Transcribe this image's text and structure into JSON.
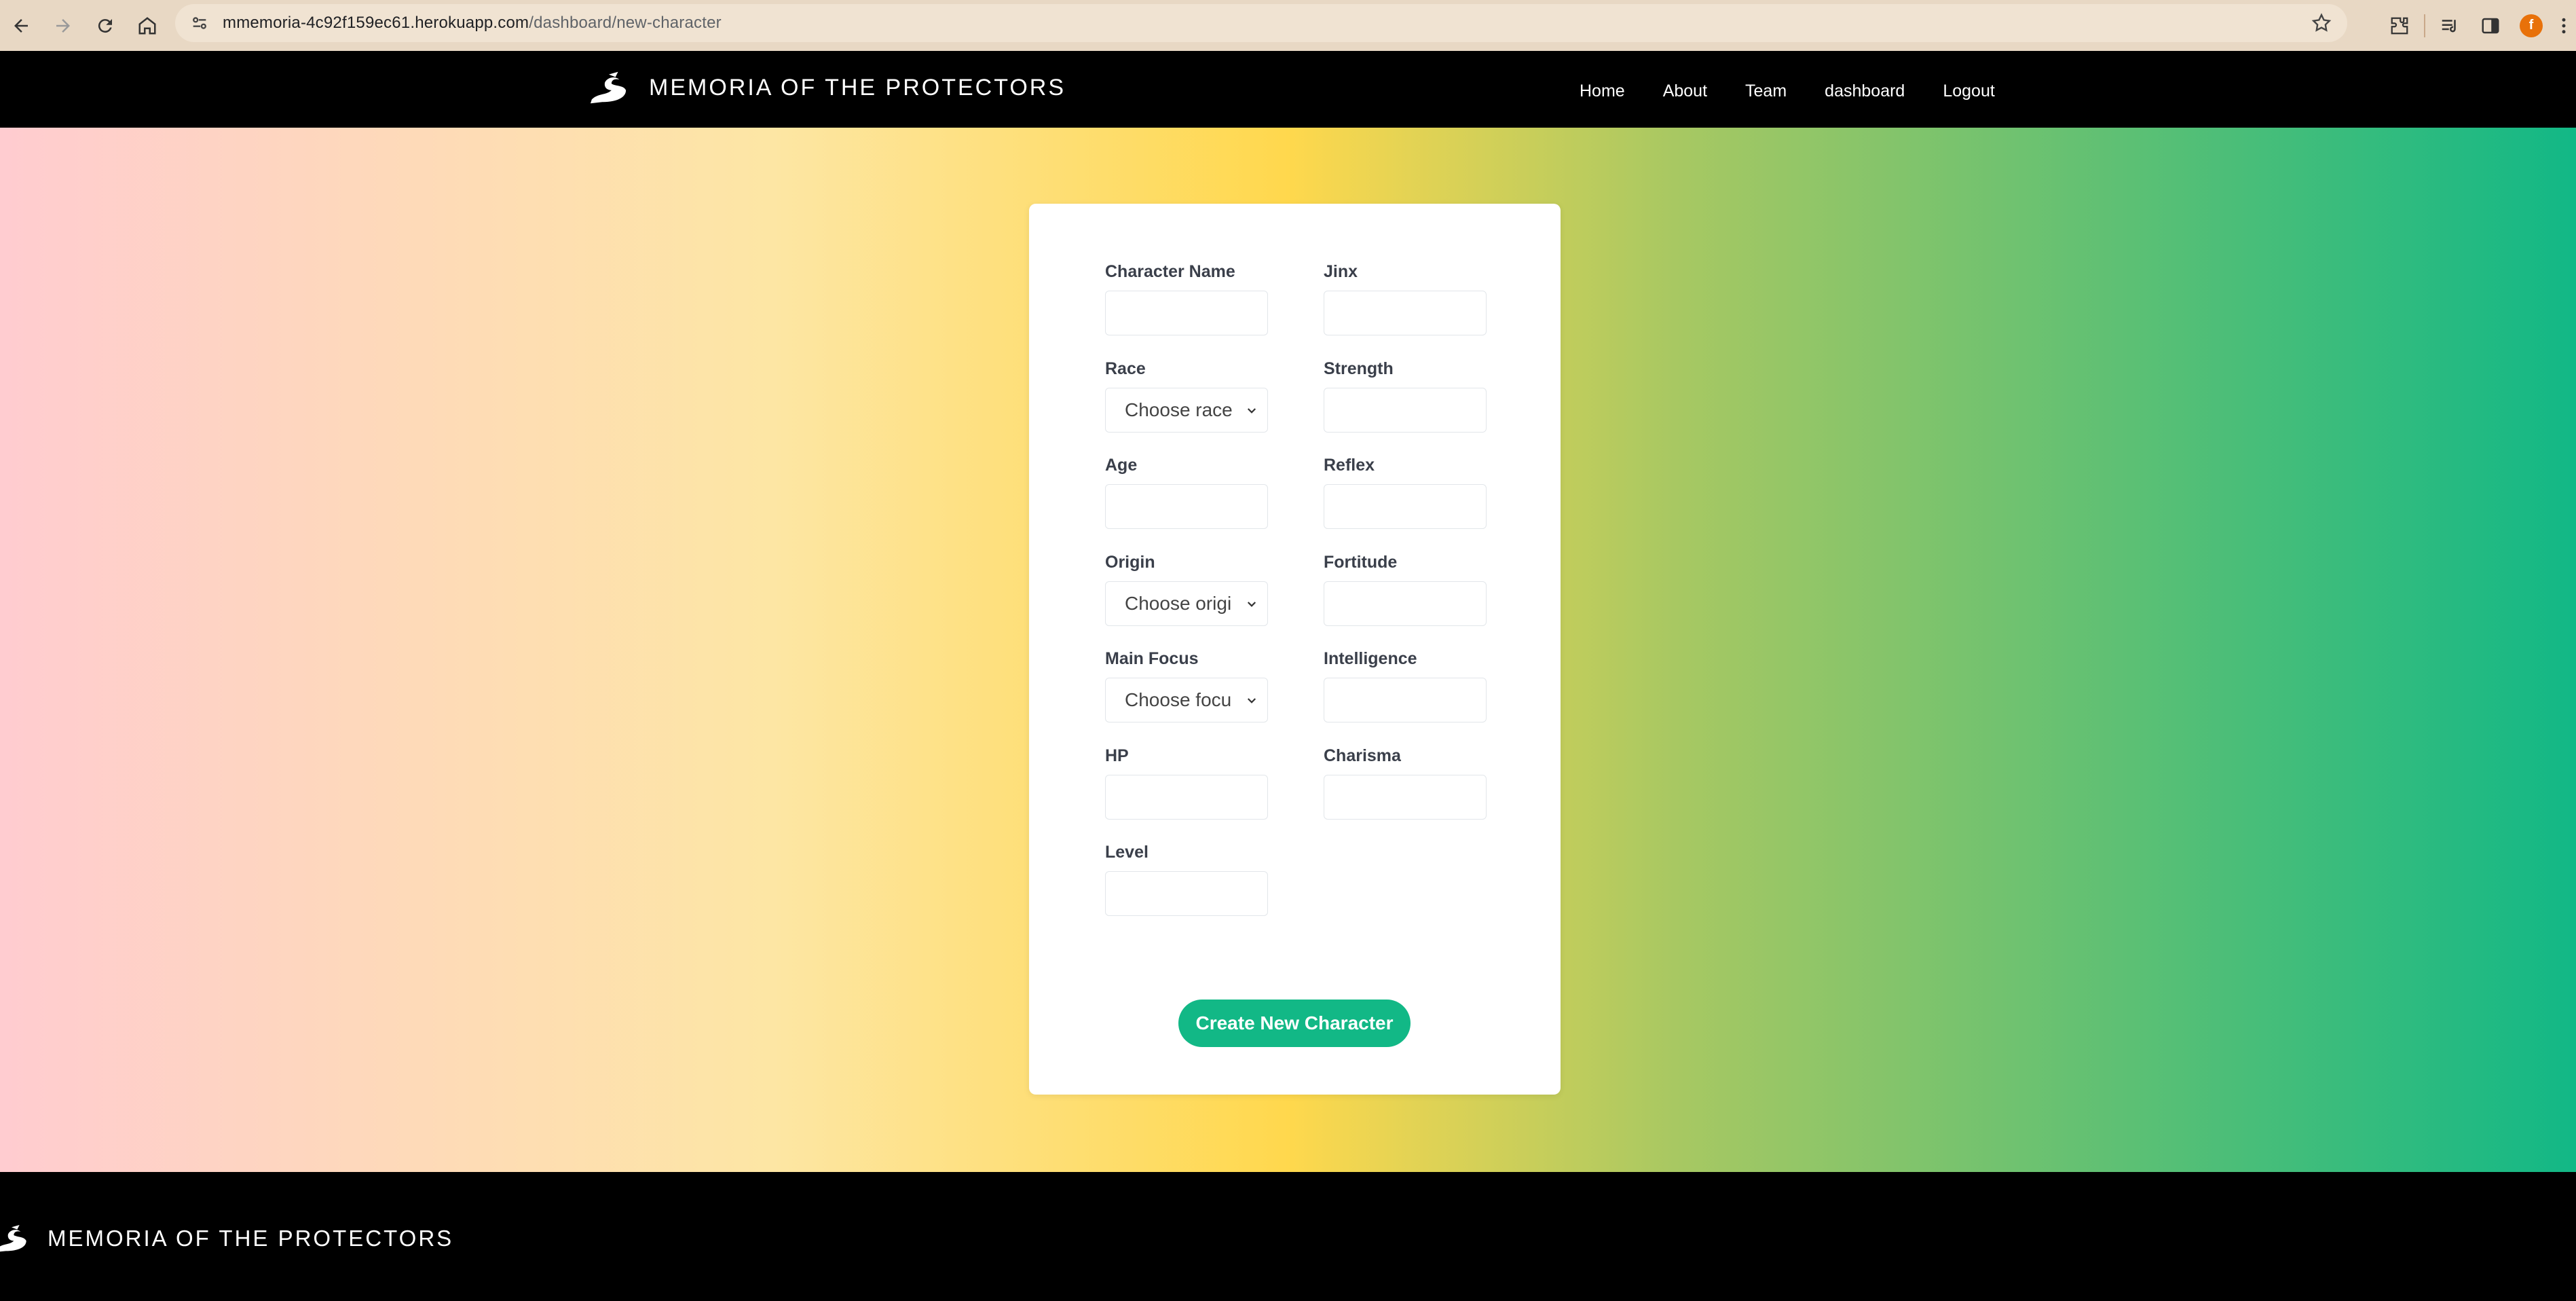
{
  "browser": {
    "url_host": "mmemoria-4c92f159ec61.herokuapp.com",
    "url_path": "/dashboard/new-character",
    "profile_initial": "f"
  },
  "header": {
    "brand": "MEMORIA OF THE PROTECTORS",
    "nav": [
      "Home",
      "About",
      "Team",
      "dashboard",
      "Logout"
    ]
  },
  "form": {
    "left_fields": [
      {
        "label": "Character Name",
        "type": "input",
        "value": ""
      },
      {
        "label": "Race",
        "type": "select",
        "value": "Choose race"
      },
      {
        "label": "Age",
        "type": "input",
        "value": ""
      },
      {
        "label": "Origin",
        "type": "select",
        "value": "Choose origi"
      },
      {
        "label": "Main Focus",
        "type": "select",
        "value": "Choose focu"
      },
      {
        "label": "HP",
        "type": "input",
        "value": ""
      },
      {
        "label": "Level",
        "type": "input",
        "value": ""
      }
    ],
    "right_fields": [
      {
        "label": "Jinx",
        "type": "input",
        "value": ""
      },
      {
        "label": "Strength",
        "type": "input",
        "value": ""
      },
      {
        "label": "Reflex",
        "type": "input",
        "value": ""
      },
      {
        "label": "Fortitude",
        "type": "input",
        "value": ""
      },
      {
        "label": "Intelligence",
        "type": "input",
        "value": ""
      },
      {
        "label": "Charisma",
        "type": "input",
        "value": ""
      }
    ],
    "submit_label": "Create New Character"
  },
  "footer": {
    "brand": "MEMORIA OF THE PROTECTORS"
  },
  "colors": {
    "accent": "#12b886",
    "header_bg": "#000000"
  }
}
